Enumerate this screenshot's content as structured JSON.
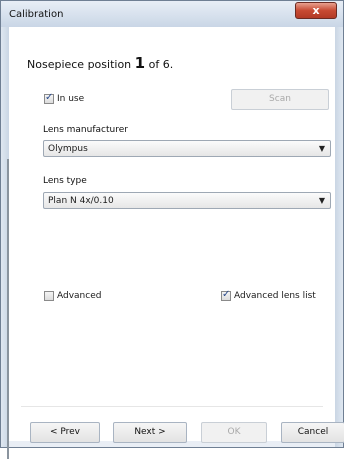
{
  "window": {
    "title": "Calibration",
    "close_label": "x"
  },
  "heading": {
    "prefix": "Nosepiece position",
    "number": "1",
    "suffix": "of 6."
  },
  "in_use": {
    "label": "In use",
    "checked": true
  },
  "scan_button": {
    "label": "Scan",
    "enabled": false
  },
  "lens_manufacturer": {
    "label": "Lens manufacturer",
    "value": "Olympus"
  },
  "lens_type": {
    "label": "Lens type",
    "value": "Plan N 4x/0.10"
  },
  "advanced": {
    "label": "Advanced",
    "checked": false
  },
  "advanced_lens_list": {
    "label": "Advanced lens list",
    "checked": true
  },
  "buttons": {
    "prev": "< Prev",
    "next": "Next >",
    "ok": "OK",
    "cancel": "Cancel"
  }
}
